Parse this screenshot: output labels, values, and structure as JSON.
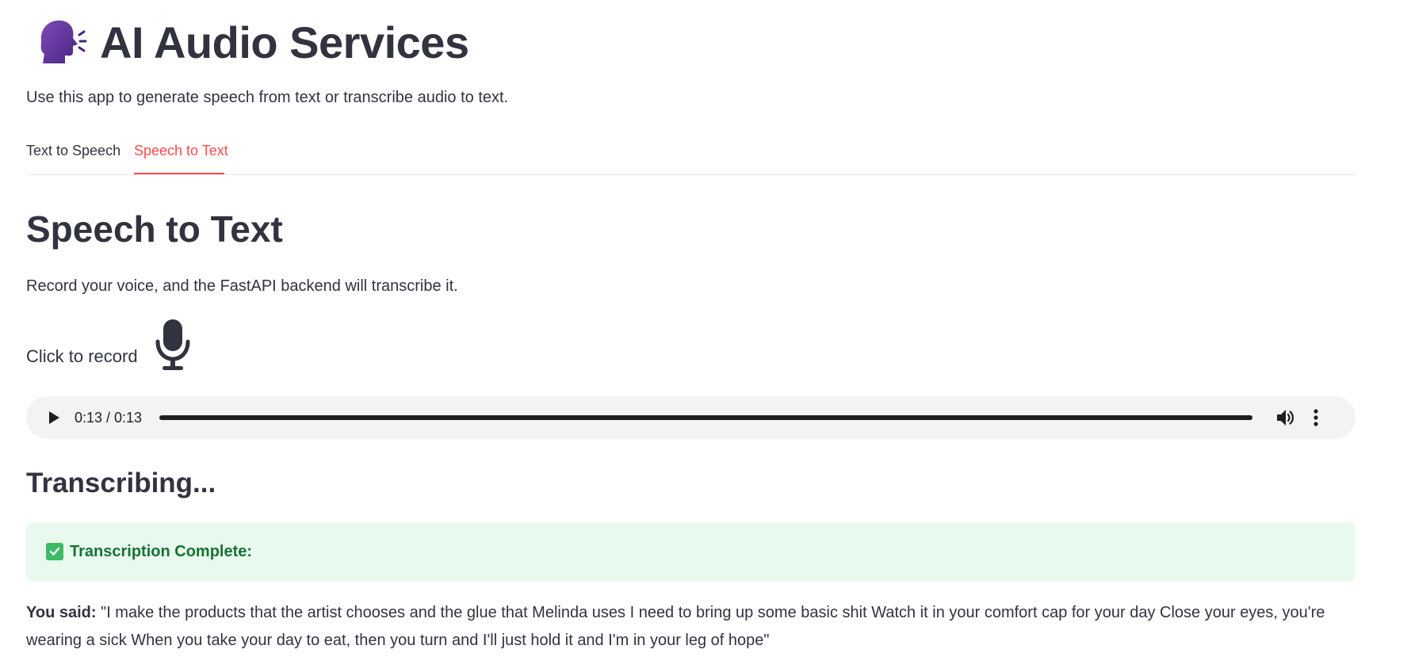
{
  "header": {
    "icon": "speaking-head-icon",
    "title": "AI Audio Services",
    "subtitle": "Use this app to generate speech from text or transcribe audio to text."
  },
  "tabs": [
    {
      "label": "Text to Speech",
      "active": false
    },
    {
      "label": "Speech to Text",
      "active": true
    }
  ],
  "section": {
    "title": "Speech to Text",
    "description": "Record your voice, and the FastAPI backend will transcribe it."
  },
  "recorder": {
    "label": "Click to record",
    "icon": "microphone-icon"
  },
  "audio_player": {
    "time": "0:13 / 0:13",
    "progress_fraction": 1.0,
    "icons": [
      "play-icon",
      "volume-icon",
      "more-options-icon"
    ]
  },
  "status": {
    "heading": "Transcribing...",
    "success_message": "Transcription Complete:",
    "success_icon": "check-mark-icon"
  },
  "result": {
    "label": "You said:",
    "text": " \"I make the products that the artist chooses and the glue that Melinda uses I need to bring up some basic shit Watch it in your comfort cap for your day Close your eyes, you're wearing a sick When you take your day to eat, then you turn and I'll just hold it and I'm in your leg of hope\""
  },
  "colors": {
    "accent": "#ff4b4b",
    "text": "#31333f",
    "success_bg": "#e8f9ee",
    "success_text": "#177233",
    "player_bg": "#f1f3f4"
  }
}
